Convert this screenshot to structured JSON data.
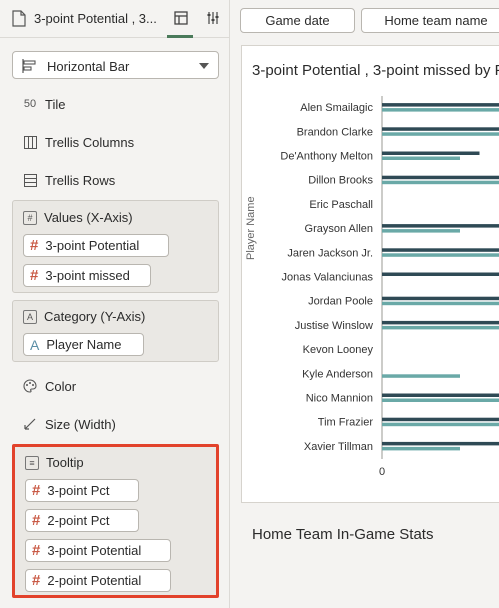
{
  "topbar": {
    "title": "3-point Potential , 3...",
    "icons": [
      "document-icon",
      "layout-grid-icon",
      "sliders-icon"
    ]
  },
  "chart_type_select": {
    "value": "Horizontal Bar",
    "icon": "horizontal-bar-chart-icon"
  },
  "grammar": {
    "tile": "Tile",
    "trellis_columns": "Trellis Columns",
    "trellis_rows": "Trellis Rows",
    "values": {
      "label": "Values (X-Axis)",
      "items": [
        "3-point Potential",
        "3-point missed"
      ]
    },
    "category": {
      "label": "Category (Y-Axis)",
      "items": [
        "Player Name"
      ]
    },
    "color": "Color",
    "size": "Size (Width)",
    "tooltip": {
      "label": "Tooltip",
      "items": [
        "3-point Pct",
        "2-point Pct",
        "3-point Potential",
        "2-point Potential"
      ]
    }
  },
  "filters": [
    "Game date",
    "Home team name"
  ],
  "colors": {
    "series_dark": "#2f4a55",
    "series_teal": "#6aa9a7",
    "highlight": "#e2422b",
    "accent_green": "#4a7a5a"
  },
  "chart_data": {
    "type": "bar",
    "orientation": "horizontal",
    "title": "3-point Potential , 3-point missed by P",
    "ylabel": "Player Name",
    "x_tick_labels": [
      "0"
    ],
    "categories": [
      "Alen Smailagic",
      "Brandon Clarke",
      "De'Anthony Melton",
      "Dillon Brooks",
      "Eric Paschall",
      "Grayson Allen",
      "Jaren Jackson Jr.",
      "Jonas Valanciunas",
      "Jordan Poole",
      "Justise Winslow",
      "Kevon Looney",
      "Kyle Anderson",
      "Nico Mannion",
      "Tim Frazier",
      "Xavier Tillman"
    ],
    "series": [
      {
        "values": [
          1,
          1,
          0.75,
          1,
          0,
          1,
          1,
          1,
          1,
          1,
          0,
          0,
          1,
          1,
          1
        ]
      },
      {
        "values": [
          1,
          1,
          0.6,
          1,
          0,
          0.6,
          1,
          0,
          1,
          1,
          0,
          0.6,
          1,
          1,
          0.6
        ]
      }
    ]
  },
  "next_section_title": "Home Team In-Game Stats"
}
